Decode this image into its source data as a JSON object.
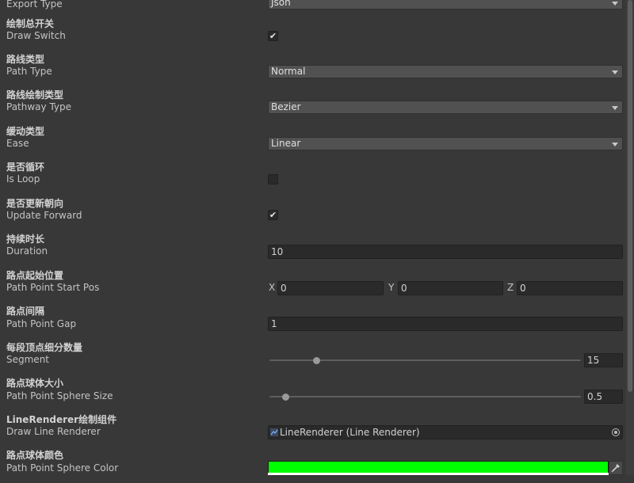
{
  "fields": {
    "export_type": {
      "en": "Export Type",
      "value": "Json"
    },
    "draw_switch": {
      "cn": "绘制总开关",
      "en": "Draw Switch",
      "checked": true
    },
    "path_type": {
      "cn": "路线类型",
      "en": "Path Type",
      "value": "Normal"
    },
    "pathway_type": {
      "cn": "路线绘制类型",
      "en": "Pathway Type",
      "value": "Bezier"
    },
    "ease": {
      "cn": "缓动类型",
      "en": "Ease",
      "value": "Linear"
    },
    "is_loop": {
      "cn": "是否循环",
      "en": "Is Loop",
      "checked": false
    },
    "update_forward": {
      "cn": "是否更新朝向",
      "en": "Update Forward",
      "checked": true
    },
    "duration": {
      "cn": "持续时长",
      "en": "Duration",
      "value": "10"
    },
    "start_pos": {
      "cn": "路点起始位置",
      "en": "Path Point Start Pos",
      "x_label": "X",
      "x": "0",
      "y_label": "Y",
      "y": "0",
      "z_label": "Z",
      "z": "0"
    },
    "gap": {
      "cn": "路点间隔",
      "en": "Path Point Gap",
      "value": "1"
    },
    "segment": {
      "cn": "每段顶点细分数量",
      "en": "Segment",
      "value": "15",
      "slider_fraction": 0.15
    },
    "sphere_size": {
      "cn": "路点球体大小",
      "en": "Path Point Sphere Size",
      "value": "0.5",
      "slider_fraction": 0.05
    },
    "line_renderer": {
      "cn": "LineRenderer绘制组件",
      "en": "Draw Line Renderer",
      "value": "LineRenderer (Line Renderer)",
      "icon": "line-renderer-icon"
    },
    "sphere_color": {
      "cn": "路点球体颜色",
      "en": "Path Point Sphere Color",
      "color": "#00ff00",
      "icon": "eyedropper-icon"
    }
  },
  "colors": {
    "background": "#383838",
    "field_bg": "#2a2a2a",
    "dropdown_bg": "#515151",
    "checkmark": "#e6e6e6"
  },
  "glyphs": {
    "checkmark": "✔"
  }
}
